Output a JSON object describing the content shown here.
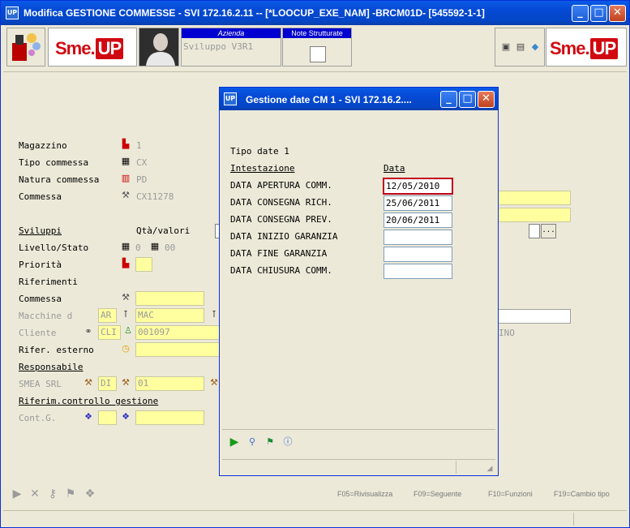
{
  "window": {
    "title": "Modifica   GESTIONE COMMESSE - SVI 172.16.2.11 -- [*LOOCUP_EXE_NAM] -BRCM01D- [545592-1-1]",
    "app_icon": "UP"
  },
  "toolbar": {
    "logo_left": {
      "sme": "Sme.",
      "up": "UP"
    },
    "logo_right": {
      "sme": "Sme.",
      "up": "UP"
    },
    "azienda_header": "Azienda",
    "azienda_value": "Sviluppo V3R1",
    "note_header": "Note Strutturate"
  },
  "form": {
    "magazzino": {
      "label": "Magazzino",
      "value": "1"
    },
    "tipo_commessa": {
      "label": "Tipo commessa",
      "value": "CX"
    },
    "natura_commessa": {
      "label": "Natura commessa",
      "value": "PD"
    },
    "commessa": {
      "label": "Commessa",
      "value": "CX11278"
    },
    "sviluppi": "Sviluppi",
    "qta_valori": "Qtà/valori",
    "livello_stato": {
      "label": "Livello/Stato",
      "v1": "0",
      "v2": "00"
    },
    "priorita": {
      "label": "Priorità"
    },
    "riferimenti": "Riferimenti",
    "rif_commessa": {
      "label": "Commessa"
    },
    "macchine": {
      "label": "Macchine d",
      "v1": "AR",
      "v2": "MAC"
    },
    "cliente": {
      "label": "Cliente",
      "v1": "CLI",
      "v2": "001097"
    },
    "rifer_esterno": {
      "label": "Rifer. esterno"
    },
    "responsabile": "Responsabile",
    "smea": {
      "label": "SMEA SRL",
      "v1": "DI",
      "v2": "01"
    },
    "riferim_controllo": "Riferim.controllo gestione",
    "cont_g": {
      "label": "Cont.G."
    },
    "partial_right": "INO"
  },
  "function_keys": [
    "F05=Rivisualizza",
    "F09=Seguente",
    "F10=Funzioni",
    "F19=Cambio tipo"
  ],
  "dialog": {
    "title": "Gestione date CM 1 - SVI 172.16.2....",
    "tipo_date": "Tipo date 1",
    "col_intestazione": "Intestazione",
    "col_data": "Data",
    "rows": [
      {
        "label": "DATA APERTURA COMM.",
        "value": "12/05/2010"
      },
      {
        "label": "DATA CONSEGNA RICH.",
        "value": "25/06/2011"
      },
      {
        "label": "DATA CONSEGNA PREV.",
        "value": "20/06/2011"
      },
      {
        "label": "DATA INIZIO GARANZIA",
        "value": ""
      },
      {
        "label": "DATA FINE GARANZIA",
        "value": ""
      },
      {
        "label": "DATA CHIUSURA COMM.",
        "value": ""
      }
    ]
  }
}
